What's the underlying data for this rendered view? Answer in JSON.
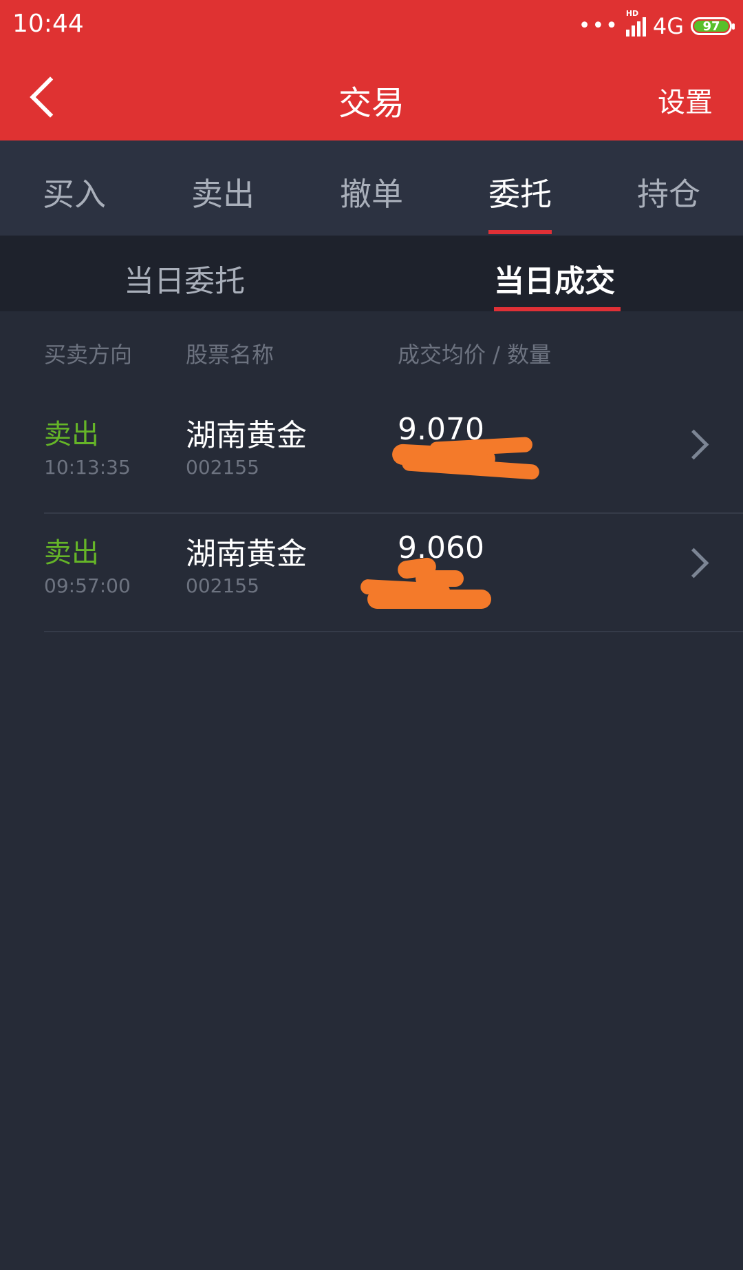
{
  "status_bar": {
    "time": "10:44",
    "dots": "•••",
    "hd": "HD",
    "network": "4G",
    "battery": "97"
  },
  "header": {
    "title": "交易",
    "settings_label": "设置"
  },
  "tabs": [
    {
      "label": "买入"
    },
    {
      "label": "卖出"
    },
    {
      "label": "撤单"
    },
    {
      "label": "委托",
      "active": true
    },
    {
      "label": "持仓"
    }
  ],
  "subtabs": [
    {
      "label": "当日委托"
    },
    {
      "label": "当日成交",
      "active": true
    }
  ],
  "columns": {
    "direction": "买卖方向",
    "name": "股票名称",
    "price_qty": "成交均价 / 数量"
  },
  "rows": [
    {
      "direction": "卖出",
      "time": "10:13:35",
      "name": "湖南黄金",
      "code": "002155",
      "price": "9.070"
    },
    {
      "direction": "卖出",
      "time": "09:57:00",
      "name": "湖南黄金",
      "code": "002155",
      "price": "9.060"
    }
  ],
  "colors": {
    "accent_red": "#df3232",
    "sell_green": "#65b528",
    "background": "#262b37",
    "redaction": "#f47a2a"
  }
}
